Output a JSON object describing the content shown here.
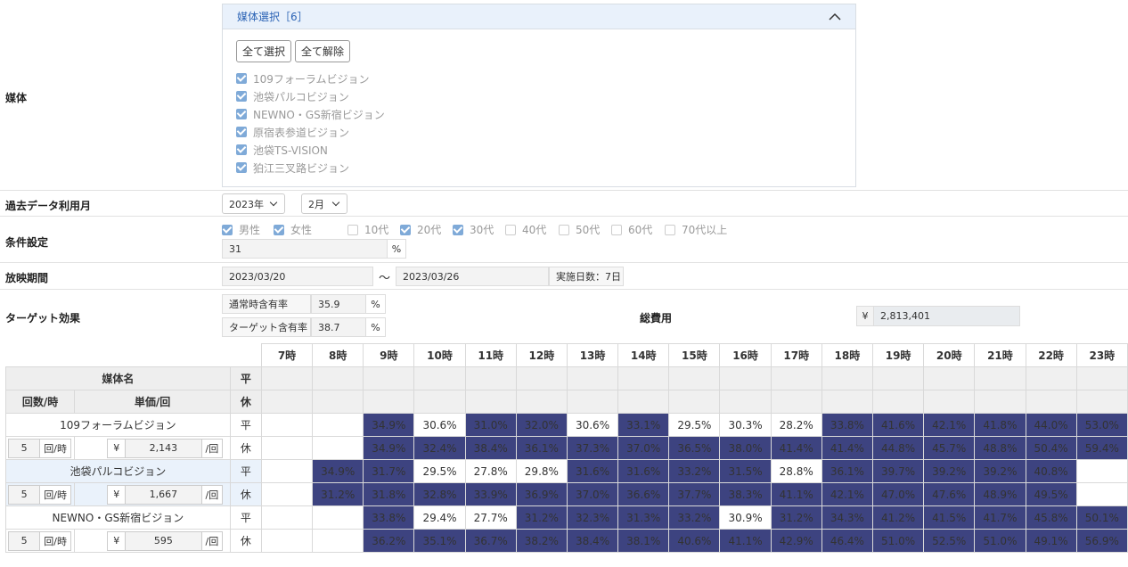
{
  "labels": {
    "media": "媒体",
    "past_month": "過去データ利用月",
    "conditions": "条件設定",
    "period": "放映期間",
    "target_effect": "ターゲット効果",
    "total_cost": "総費用"
  },
  "media_panel": {
    "title": "媒体選択［6］",
    "select_all": "全て選択",
    "clear_all": "全て解除",
    "items": [
      "109フォーラムビジョン",
      "池袋パルコビジョン",
      "NEWNO・GS新宿ビジョン",
      "原宿表参道ビジョン",
      "池袋TS-VISION",
      "狛江三叉路ビジョン"
    ]
  },
  "past_data": {
    "year": "2023年",
    "month": "2月"
  },
  "conditions": {
    "options": [
      {
        "label": "男性",
        "checked": true
      },
      {
        "label": "女性",
        "checked": true
      },
      {
        "label": "10代",
        "checked": false
      },
      {
        "label": "20代",
        "checked": true
      },
      {
        "label": "30代",
        "checked": true
      },
      {
        "label": "40代",
        "checked": false
      },
      {
        "label": "50代",
        "checked": false
      },
      {
        "label": "60代",
        "checked": false
      },
      {
        "label": "70代以上",
        "checked": false
      }
    ],
    "rate_value": "31",
    "rate_unit": "%"
  },
  "period": {
    "start": "2023/03/20",
    "sep": "〜",
    "end": "2023/03/26",
    "days": "実施日数：7日"
  },
  "target": {
    "normal_label": "通常時含有率",
    "normal_value": "35.9",
    "target_label": "ターゲット含有率",
    "target_value": "38.7",
    "unit": "%"
  },
  "cost": {
    "currency": "¥",
    "value": "2,813,401"
  },
  "table": {
    "hours": [
      "7時",
      "8時",
      "9時",
      "10時",
      "11時",
      "12時",
      "13時",
      "14時",
      "15時",
      "16時",
      "17時",
      "18時",
      "19時",
      "20時",
      "21時",
      "22時",
      "23時"
    ],
    "header": {
      "media_name": "媒体名",
      "count": "回数/時",
      "unit_price": "単価/回",
      "weekday": "平",
      "holiday": "休"
    },
    "rows": [
      {
        "name": "109フォーラムビジョン",
        "count": "5",
        "count_unit": "回/時",
        "currency": "¥",
        "price": "2,143",
        "price_unit": "/回",
        "weekday": [
          "",
          "",
          "34.9%",
          "30.6%",
          "31.0%",
          "32.0%",
          "30.6%",
          "33.1%",
          "29.5%",
          "30.3%",
          "28.2%",
          "33.8%",
          "41.6%",
          "42.1%",
          "41.8%",
          "44.0%",
          "53.0%"
        ],
        "weekday_dark": [
          0,
          0,
          1,
          0,
          1,
          1,
          0,
          1,
          0,
          0,
          0,
          1,
          1,
          1,
          1,
          1,
          1
        ],
        "holiday": [
          "",
          "",
          "34.9%",
          "32.4%",
          "38.4%",
          "36.1%",
          "37.3%",
          "37.0%",
          "36.5%",
          "38.0%",
          "41.4%",
          "41.4%",
          "44.8%",
          "45.7%",
          "48.8%",
          "50.4%",
          "59.4%"
        ],
        "holiday_dark": [
          0,
          0,
          1,
          1,
          1,
          1,
          1,
          1,
          1,
          1,
          1,
          1,
          1,
          1,
          1,
          1,
          1
        ]
      },
      {
        "name": "池袋パルコビジョン",
        "count": "5",
        "count_unit": "回/時",
        "currency": "¥",
        "price": "1,667",
        "price_unit": "/回",
        "weekday": [
          "",
          "34.9%",
          "31.7%",
          "29.5%",
          "27.8%",
          "29.8%",
          "31.6%",
          "31.6%",
          "33.2%",
          "31.5%",
          "28.8%",
          "36.1%",
          "39.7%",
          "39.2%",
          "39.2%",
          "40.8%",
          ""
        ],
        "weekday_dark": [
          0,
          1,
          1,
          0,
          0,
          0,
          1,
          1,
          1,
          1,
          0,
          1,
          1,
          1,
          1,
          1,
          0
        ],
        "holiday": [
          "",
          "31.2%",
          "31.8%",
          "32.8%",
          "33.9%",
          "36.9%",
          "37.0%",
          "36.6%",
          "37.7%",
          "38.3%",
          "41.1%",
          "42.1%",
          "47.0%",
          "47.6%",
          "48.9%",
          "49.5%",
          ""
        ],
        "holiday_dark": [
          0,
          1,
          1,
          1,
          1,
          1,
          1,
          1,
          1,
          1,
          1,
          1,
          1,
          1,
          1,
          1,
          0
        ]
      },
      {
        "name": "NEWNO・GS新宿ビジョン",
        "count": "5",
        "count_unit": "回/時",
        "currency": "¥",
        "price": "595",
        "price_unit": "/回",
        "weekday": [
          "",
          "",
          "33.8%",
          "29.4%",
          "27.7%",
          "31.2%",
          "32.3%",
          "31.3%",
          "33.2%",
          "30.9%",
          "31.2%",
          "34.3%",
          "41.2%",
          "41.5%",
          "41.7%",
          "45.8%",
          "50.1%"
        ],
        "weekday_dark": [
          0,
          0,
          1,
          0,
          0,
          1,
          1,
          1,
          1,
          0,
          1,
          1,
          1,
          1,
          1,
          1,
          1
        ],
        "holiday": [
          "",
          "",
          "36.2%",
          "35.1%",
          "36.7%",
          "38.2%",
          "38.4%",
          "38.1%",
          "40.6%",
          "41.1%",
          "42.9%",
          "46.4%",
          "51.0%",
          "52.5%",
          "51.0%",
          "49.1%",
          "56.9%"
        ],
        "holiday_dark": [
          0,
          0,
          1,
          1,
          1,
          1,
          1,
          1,
          1,
          1,
          1,
          1,
          1,
          1,
          1,
          1,
          1
        ]
      }
    ]
  }
}
